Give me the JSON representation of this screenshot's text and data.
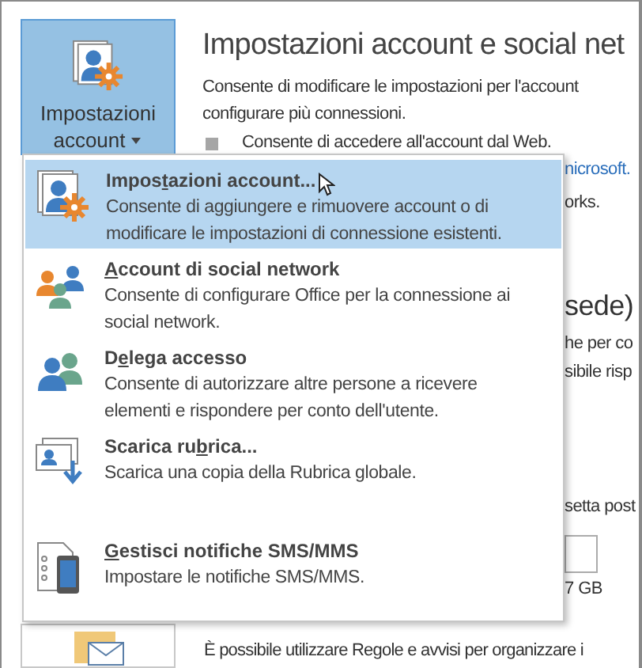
{
  "ribbon_button": {
    "label_lines": [
      "Impostazioni",
      "account"
    ],
    "selected": true
  },
  "section": {
    "title": "Impostazioni account e social net",
    "description_lines": [
      "Consente di modificare le impostazioni per l'account",
      "configurare più connessioni."
    ],
    "bullet": "Consente di accedere all'account dal Web."
  },
  "menu": {
    "items": [
      {
        "kind": "account-settings",
        "label": {
          "before": "Impos",
          "key": "t",
          "after": "azioni account..."
        },
        "description": "Consente di aggiungere e rimuovere account o di modificare le impostazioni di connessione esistenti.",
        "selected": true
      },
      {
        "kind": "social",
        "label": {
          "key": "A",
          "after": "ccount di social network"
        },
        "description": "Consente di configurare Office per la connessione ai social network.",
        "selected": false
      },
      {
        "kind": "delegate",
        "label": {
          "before": "D",
          "key": "e",
          "after": "lega accesso"
        },
        "description": "Consente di autorizzare altre persone a ricevere elementi e rispondere per conto dell'utente.",
        "selected": false
      },
      {
        "kind": "address-book",
        "label": {
          "before": "Scarica ru",
          "key": "b",
          "after": "rica..."
        },
        "description": "Scarica una copia della Rubrica globale.",
        "selected": false
      },
      {
        "kind": "sms",
        "label": {
          "key": "G",
          "after": "estisci notifiche SMS/MMS"
        },
        "description": "Impostare le notifiche SMS/MMS.",
        "selected": false
      }
    ]
  },
  "background_fragments": [
    {
      "kind": "link",
      "text": "nicrosoft."
    },
    {
      "kind": "text",
      "text": "orks."
    },
    {
      "kind": "heading",
      "text": "sede)"
    },
    {
      "kind": "text",
      "text": "he per co"
    },
    {
      "kind": "text",
      "text": "sibile risp"
    },
    {
      "kind": "text",
      "text": "setta post"
    },
    {
      "kind": "box"
    },
    {
      "kind": "text",
      "text": "7 GB"
    }
  ],
  "rules_description": "È possibile utilizzare Regole e avvisi per organizzare i"
}
